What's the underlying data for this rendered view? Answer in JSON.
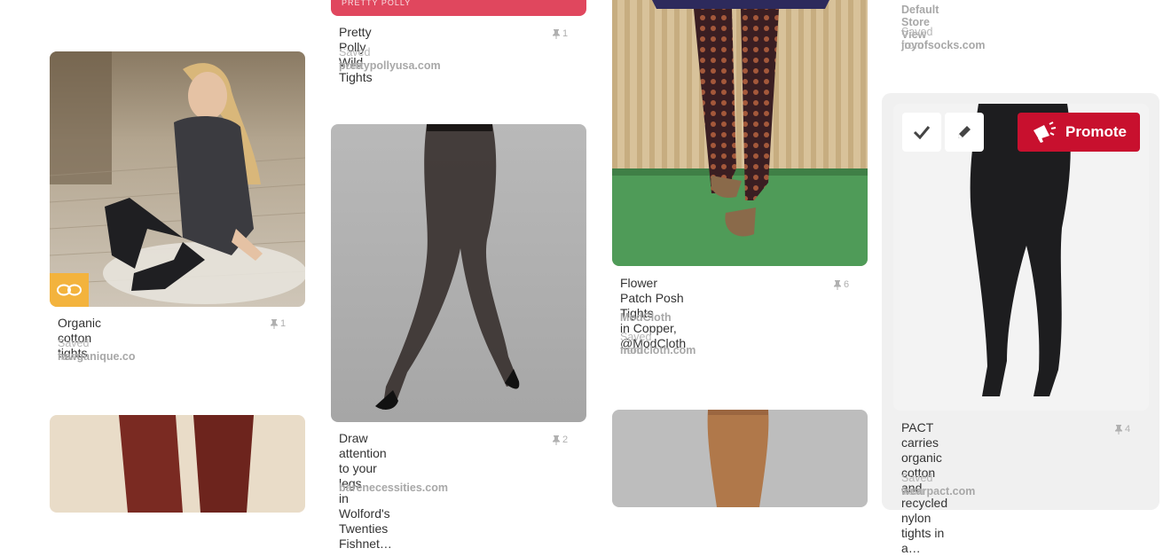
{
  "pins": [
    {
      "id": "organic",
      "title": "Organic cotton tights",
      "count": "1",
      "saved_label": "Saved from",
      "domain": "rawganique.co"
    },
    {
      "id": "polly",
      "banner": "PRETTY POLLY",
      "title": "Pretty Polly Wild Tights",
      "count": "1",
      "saved_label": "Saved from",
      "domain": "prettypollyusa.com"
    },
    {
      "id": "wolford",
      "title_lines": [
        "Draw attention to your legs",
        "in Wolford's Twenties",
        "Fishnet…"
      ],
      "count": "2",
      "domain": "barenecessities.com"
    },
    {
      "id": "flower",
      "title_lines": [
        "Flower Patch Posh Tights",
        "in Copper, @ModCloth"
      ],
      "count": "6",
      "source": "ModCloth",
      "saved_label": "Saved from",
      "domain": "modcloth.com"
    },
    {
      "id": "store",
      "store": "Default Store View",
      "saved_label": "Saved from",
      "domain": "joyofsocks.com"
    },
    {
      "id": "pact",
      "title_lines": [
        "PACT carries organic",
        "cotton and recycled nylon",
        "tights in a…"
      ],
      "count": "4",
      "saved_label": "Saved from",
      "domain": "wearpact.com"
    }
  ],
  "actions": {
    "promote_label": "Promote",
    "check_icon": "check-icon",
    "edit_icon": "pencil-icon",
    "promote_icon": "megaphone-icon"
  },
  "colors": {
    "promote": "#c8102e",
    "polly_banner": "#e0475e",
    "hover_card": "#f0f0f0"
  }
}
